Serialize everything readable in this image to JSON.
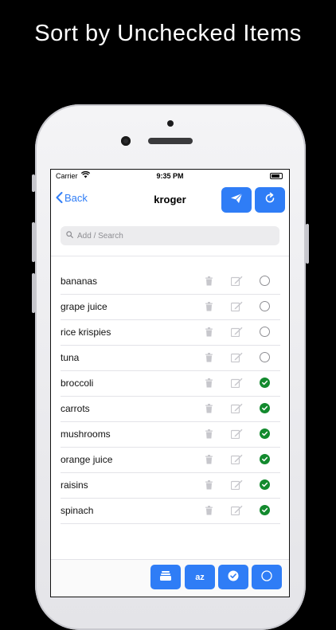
{
  "headline": "Sort by Unchecked Items",
  "status_bar": {
    "carrier": "Carrier",
    "time": "9:35 PM"
  },
  "nav": {
    "back_label": "Back",
    "title": "kroger",
    "share_icon": "paper-plane-icon",
    "refresh_icon": "refresh-icon"
  },
  "search": {
    "placeholder": "Add / Search"
  },
  "items": [
    {
      "name": "bananas",
      "checked": false
    },
    {
      "name": "grape juice",
      "checked": false
    },
    {
      "name": "rice krispies",
      "checked": false
    },
    {
      "name": "tuna",
      "checked": false
    },
    {
      "name": "broccoli",
      "checked": true
    },
    {
      "name": "carrots",
      "checked": true
    },
    {
      "name": "mushrooms",
      "checked": true
    },
    {
      "name": "orange juice",
      "checked": true
    },
    {
      "name": "raisins",
      "checked": true
    },
    {
      "name": "spinach",
      "checked": true
    }
  ],
  "toolbar": {
    "sort_az_label": "az",
    "stack_icon": "stack-icon",
    "sort_checked_icon": "checkmark-circle-icon",
    "sort_unchecked_icon": "circle-icon"
  },
  "colors": {
    "accent": "#2f7df6",
    "checked": "#138a2e",
    "background": "#000000"
  }
}
